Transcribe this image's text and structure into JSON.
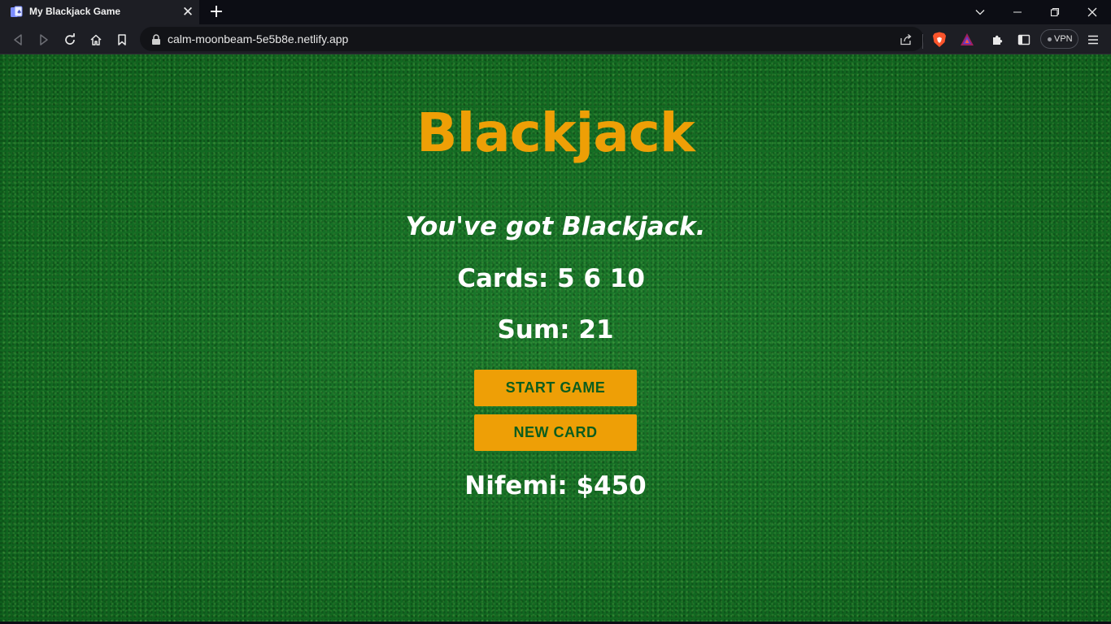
{
  "browser": {
    "tab_title": "My Blackjack Game",
    "tab_close": "✕",
    "new_tab": "+",
    "url": "calm-moonbeam-5e5b8e.netlify.app",
    "vpn_label": "VPN"
  },
  "game": {
    "title": "Blackjack",
    "message": "You've got Blackjack.",
    "cards_text": "Cards: 5 6 10 ",
    "sum_text": "Sum: 21",
    "start_button": "START GAME",
    "new_card_button": "NEW CARD",
    "player_text": "Nifemi: $450"
  },
  "colors": {
    "title": "#ee9f06",
    "button_bg": "#ee9f06",
    "button_text": "#0b5d1e",
    "table_green": "#166f25"
  },
  "icons": [
    "back-icon",
    "forward-icon",
    "reload-icon",
    "home-icon",
    "bookmark-icon",
    "lock-icon",
    "share-icon",
    "brave-shields-icon",
    "brave-rewards-icon",
    "extensions-icon",
    "sidebar-icon",
    "menu-icon",
    "minimize-icon",
    "restore-icon",
    "close-icon",
    "tab-list-icon"
  ]
}
